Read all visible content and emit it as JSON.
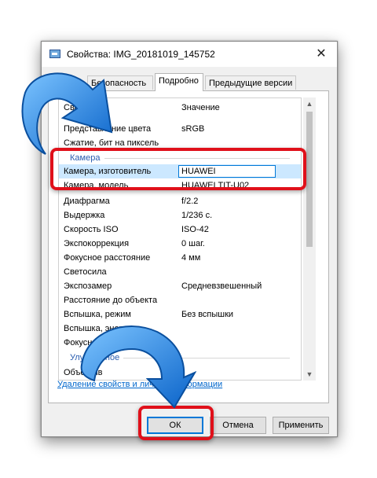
{
  "window": {
    "title": "Свойства: IMG_20181019_145752",
    "close_glyph": "✕"
  },
  "tabs": [
    {
      "label": "Безопасность"
    },
    {
      "label": "Подробно"
    },
    {
      "label": "Предыдущие версии"
    }
  ],
  "list": {
    "header": {
      "name": "Сво",
      "value": "Значение"
    },
    "rows_top": [
      {
        "name": "Представление цвета",
        "value": "sRGB"
      },
      {
        "name": "Сжатие, бит на пиксель",
        "value": ""
      }
    ],
    "group_camera": "Камера",
    "editing_row": {
      "name": "Камера, изготовитель",
      "value": "HUAWEI"
    },
    "rows_camera": [
      {
        "name": "Камера, модель",
        "value": "HUAWEI TIT-U02"
      },
      {
        "name": "Диафрагма",
        "value": "f/2.2"
      },
      {
        "name": "Выдержка",
        "value": "1/236 с."
      },
      {
        "name": "Скорость ISO",
        "value": "ISO-42"
      },
      {
        "name": "Экспокоррекция",
        "value": "0 шаг."
      },
      {
        "name": "Фокусное расстояние",
        "value": "4 мм"
      },
      {
        "name": "Светосила",
        "value": ""
      },
      {
        "name": "Экспозамер",
        "value": "Средневзвешенный"
      },
      {
        "name": "Расстояние до объекта",
        "value": ""
      },
      {
        "name": "Вспышка, режим",
        "value": "Без вспышки"
      },
      {
        "name": "Вспышка, энергия",
        "value": ""
      },
      {
        "name": "Фокусное расстояние, э",
        "value": ""
      }
    ],
    "group_improved": "Улучшенное",
    "row_cut": {
      "name": "Объектив",
      "value": ""
    }
  },
  "link": "Удаление свойств и личной информации",
  "buttons": {
    "ok": "ОК",
    "cancel": "Отмена",
    "apply": "Применить"
  },
  "colors": {
    "annotation_red": "#e0101a",
    "arrow_blue": "#1e88e5"
  }
}
